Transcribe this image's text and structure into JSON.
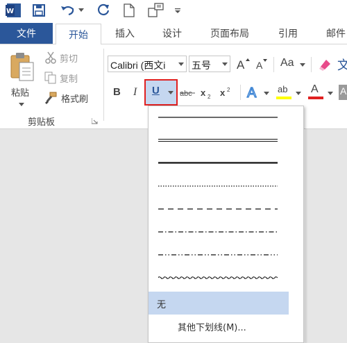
{
  "tabs": {
    "file": "文件",
    "home": "开始",
    "insert": "插入",
    "design": "设计",
    "layout": "页面布局",
    "references": "引用",
    "mailings": "邮件"
  },
  "clipboard": {
    "paste": "粘贴",
    "cut": "剪切",
    "copy": "复制",
    "format_painter": "格式刷",
    "group_label": "剪贴板"
  },
  "font": {
    "name": "Calibri (西文i",
    "size": "五号",
    "case_button": "Aa",
    "highlight_letters": "ab",
    "color_letter": "A",
    "highlight_color": "#ffff00",
    "font_color": "#e02020"
  },
  "underline_menu": {
    "options": [
      "single",
      "double",
      "thick",
      "dotted",
      "dashed",
      "dash-dot",
      "dash-dot-dot",
      "wave"
    ],
    "none_label": "无",
    "more_label": "其他下划线(M)..."
  },
  "colors": {
    "accent": "#2b579a",
    "active_border": "#e02020",
    "selected_bg": "#c5d7f0"
  }
}
